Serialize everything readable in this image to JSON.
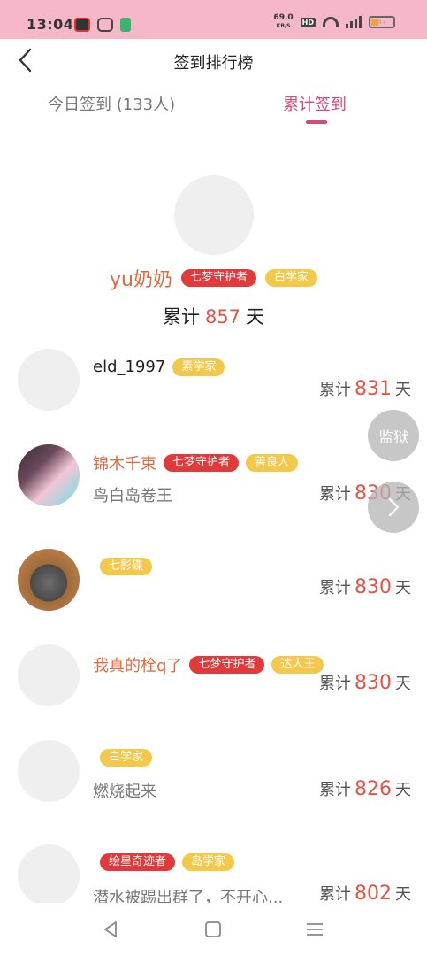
{
  "status_bar": {
    "time": "13:04",
    "speed_value": "69.0",
    "speed_unit": "KB/S",
    "hd_label": "HD",
    "battery": "47"
  },
  "header": {
    "title": "签到排行榜",
    "back_icon": "chevron-left-icon"
  },
  "tabs": [
    {
      "label": "今日签到 (133人)",
      "active": false
    },
    {
      "label": "累计签到",
      "active": true
    }
  ],
  "champion": {
    "name": "yu奶奶",
    "badges": [
      {
        "label": "七梦守护者",
        "color": "#e23a3a"
      },
      {
        "label": "白学家",
        "color": "#f4c84a"
      }
    ],
    "total_prefix": "累计",
    "total_value": "857",
    "total_suffix": "天"
  },
  "list": [
    {
      "name": "eld_1997",
      "badges": [
        "素学家"
      ],
      "sub": "",
      "total_prefix": "累计",
      "total_value": "831",
      "total_suffix": "天"
    },
    {
      "name": "锦木千束",
      "badges": [
        "七梦守护者",
        "善良人"
      ],
      "sub": "鸟白岛卷王",
      "total_prefix": "累计",
      "total_value": "830",
      "total_suffix": "天"
    },
    {
      "name": "",
      "badges": [
        "七影碟"
      ],
      "sub": "",
      "total_prefix": "累计",
      "total_value": "830",
      "total_suffix": "天"
    },
    {
      "name": "我真的栓q了",
      "badges": [
        "七梦守护者",
        "达人王"
      ],
      "sub": "",
      "total_prefix": "累计",
      "total_value": "830",
      "total_suffix": "天"
    },
    {
      "name": "",
      "badges": [
        "白学家"
      ],
      "sub": "燃烧起来",
      "total_prefix": "累计",
      "total_value": "826",
      "total_suffix": "天"
    },
    {
      "name": "",
      "badges": [
        "绘星奇迹者",
        "岛学家"
      ],
      "sub": "潜水被踢出群了，不开心...",
      "total_prefix": "累计",
      "total_value": "802",
      "total_suffix": "天"
    }
  ],
  "floating": {
    "jail_label": "监狱",
    "next_icon": "chevron-right-icon"
  },
  "nav": {
    "back_icon": "triangle-back-icon",
    "home_icon": "square-home-icon",
    "menu_icon": "menu-lines-icon"
  },
  "colors": {
    "accent": "#d24b7a",
    "status_bar": "#f6b8c8",
    "number_red": "#e05548",
    "name_orange": "#e06a3e",
    "badge_red": "#e23a3a",
    "badge_yellow": "#f4c84a"
  }
}
